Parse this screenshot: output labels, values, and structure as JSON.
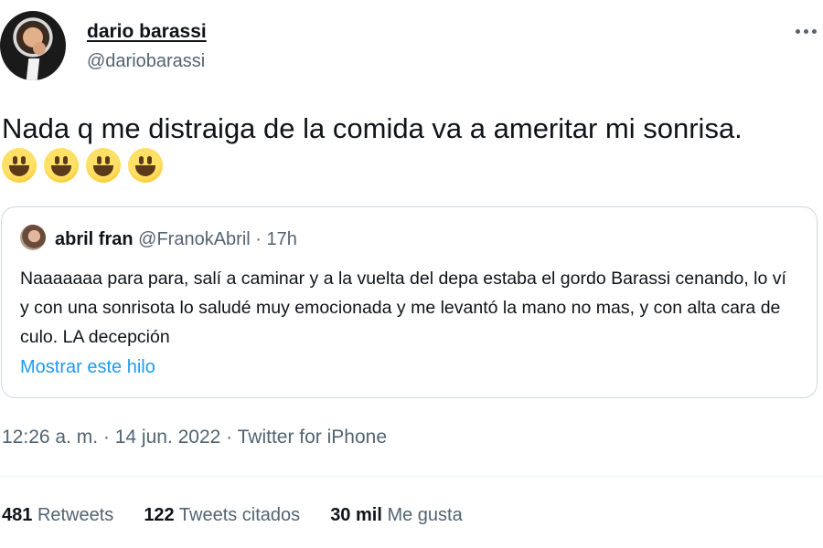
{
  "author": {
    "display_name": "dario barassi",
    "handle": "@dariobarassi"
  },
  "tweet": {
    "text": "Nada q me distraiga de la comida va a ameritar mi sonrisa.",
    "emojis": [
      "grinning-face",
      "grinning-face",
      "grinning-face",
      "grinning-face"
    ]
  },
  "quoted": {
    "display_name": "abril fran",
    "handle": "@FranokAbril",
    "separator": "·",
    "time": "17h",
    "text": "Naaaaaaa para para, salí a caminar y a la vuelta del depa estaba el gordo Barassi cenando, lo ví y con una sonrisota lo saludé muy emocionada y me levantó la mano no mas, y con alta cara de culo. LA decepción",
    "link_label": "Mostrar este hilo"
  },
  "meta": {
    "text": "12:26 a. m. · 14 jun. 2022 · Twitter for iPhone"
  },
  "stats": [
    {
      "count": "481",
      "label": "Retweets"
    },
    {
      "count": "122",
      "label": "Tweets citados"
    },
    {
      "count": "30 mil",
      "label": "Me gusta"
    }
  ],
  "colors": {
    "text": "#0f1419",
    "secondary": "#536471",
    "link": "#1d9bf0",
    "border": "#cfd9de"
  }
}
